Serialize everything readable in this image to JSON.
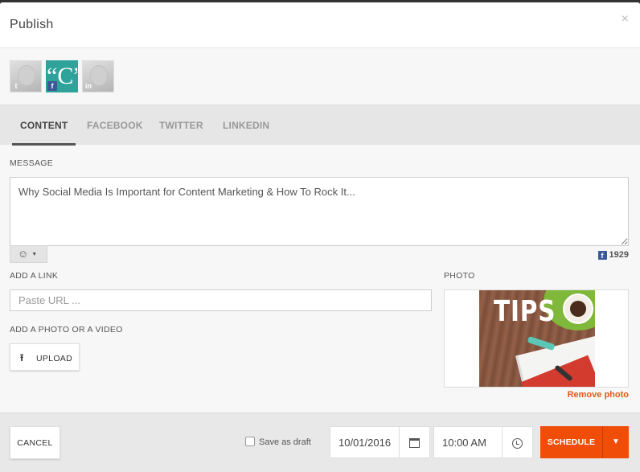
{
  "dialog": {
    "title": "Publish",
    "close_glyph": "×"
  },
  "accounts": [
    {
      "network": "twitter",
      "icon": "twitter-icon",
      "glyph": "t"
    },
    {
      "network": "facebook",
      "icon": "facebook-icon",
      "glyph": "f",
      "brand_letter": "“C”"
    },
    {
      "network": "linkedin",
      "icon": "linkedin-icon",
      "glyph": "in"
    }
  ],
  "tabs": [
    {
      "label": "CONTENT",
      "active": true
    },
    {
      "label": "FACEBOOK",
      "active": false
    },
    {
      "label": "TWITTER",
      "active": false
    },
    {
      "label": "LINKEDIN",
      "active": false
    }
  ],
  "message": {
    "label": "MESSAGE",
    "value": "Why Social Media Is Important for Content Marketing & How To Rock It...",
    "emoji_glyph": "☺",
    "char_count": "1929"
  },
  "link": {
    "label": "ADD A LINK",
    "placeholder": "Paste URL ..."
  },
  "media": {
    "label": "ADD A PHOTO OR A VIDEO",
    "upload_label": "UPLOAD"
  },
  "photo": {
    "label": "PHOTO",
    "image_text": "TIPS",
    "remove_label": "Remove photo"
  },
  "footer": {
    "cancel_label": "CANCEL",
    "draft_label": "Save as draft",
    "date": "10/01/2016",
    "time": "10:00 AM",
    "schedule_label": "SCHEDULE"
  },
  "colors": {
    "accent": "#f04e08",
    "link": "#e05a1b",
    "facebook": "#3b5998",
    "brand_teal": "#2fa39a"
  }
}
